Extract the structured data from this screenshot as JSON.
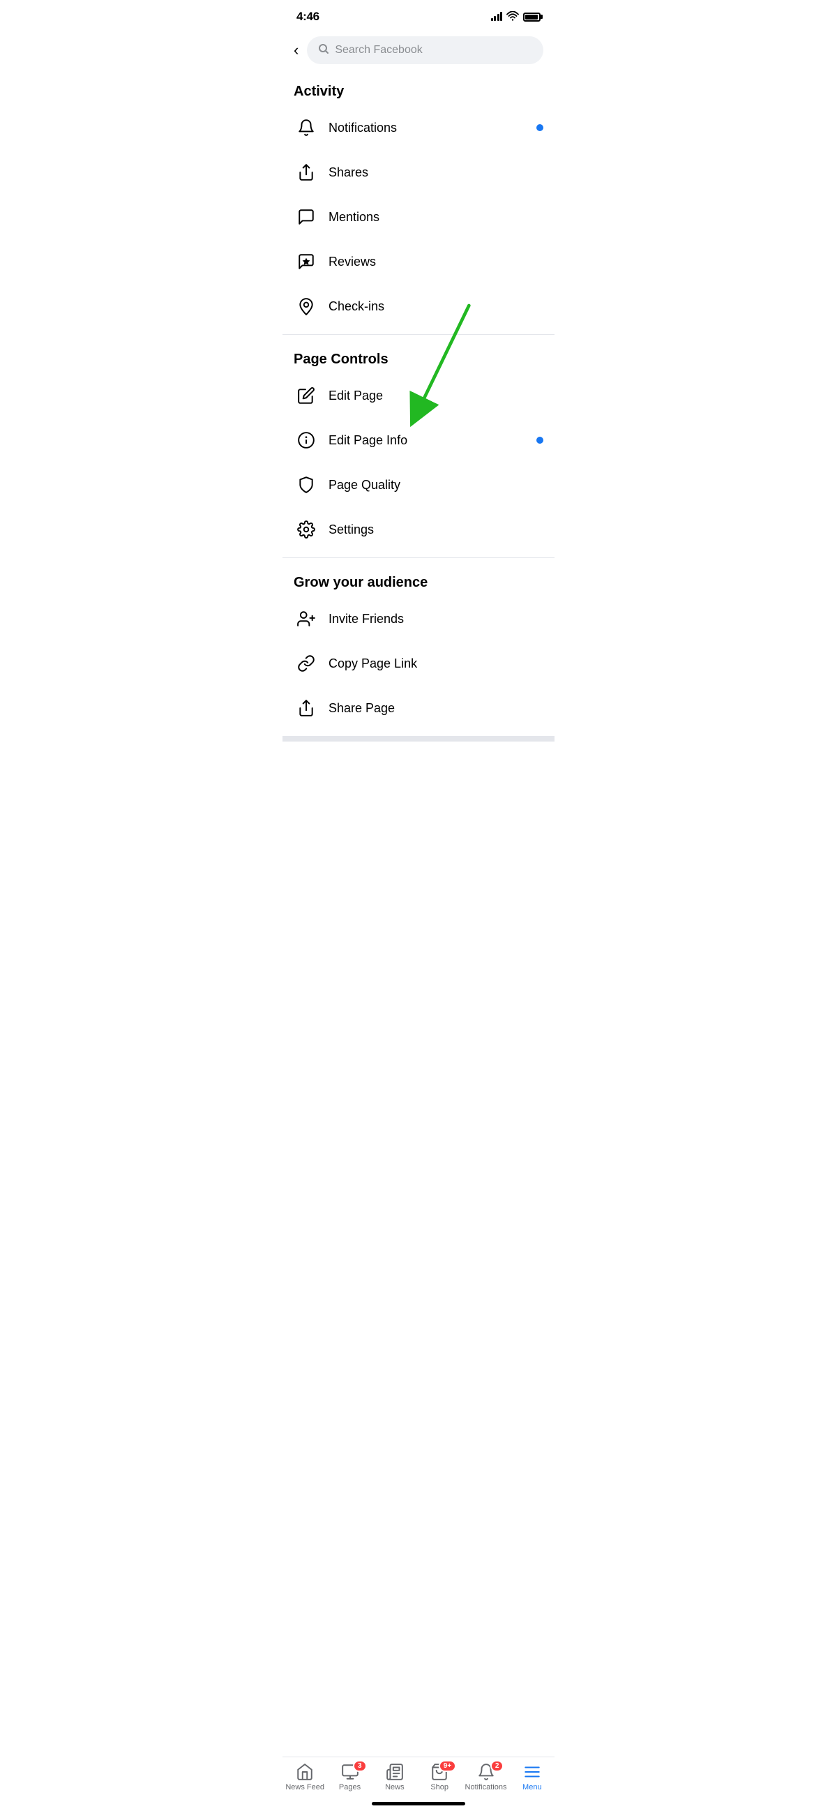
{
  "statusBar": {
    "time": "4:46",
    "signal": [
      4,
      7,
      10,
      13
    ],
    "battery": 85
  },
  "search": {
    "placeholder": "Search Facebook",
    "backLabel": "‹"
  },
  "sections": [
    {
      "id": "activity",
      "title": "Activity",
      "items": [
        {
          "id": "notifications",
          "label": "Notifications",
          "hasDot": true
        },
        {
          "id": "shares",
          "label": "Shares",
          "hasDot": false
        },
        {
          "id": "mentions",
          "label": "Mentions",
          "hasDot": false
        },
        {
          "id": "reviews",
          "label": "Reviews",
          "hasDot": false
        },
        {
          "id": "checkins",
          "label": "Check-ins",
          "hasDot": false
        }
      ]
    },
    {
      "id": "page-controls",
      "title": "Page Controls",
      "items": [
        {
          "id": "edit-page",
          "label": "Edit Page",
          "hasDot": false
        },
        {
          "id": "edit-page-info",
          "label": "Edit Page Info",
          "hasDot": true
        },
        {
          "id": "page-quality",
          "label": "Page Quality",
          "hasDot": false
        },
        {
          "id": "settings",
          "label": "Settings",
          "hasDot": false
        }
      ]
    },
    {
      "id": "grow-audience",
      "title": "Grow your audience",
      "items": [
        {
          "id": "invite-friends",
          "label": "Invite Friends",
          "hasDot": false
        },
        {
          "id": "copy-page-link",
          "label": "Copy Page Link",
          "hasDot": false
        },
        {
          "id": "share-page",
          "label": "Share Page",
          "hasDot": false
        }
      ]
    }
  ],
  "bottomNav": [
    {
      "id": "news-feed",
      "label": "News Feed",
      "badge": null,
      "active": false
    },
    {
      "id": "pages",
      "label": "Pages",
      "badge": "3",
      "active": false
    },
    {
      "id": "news",
      "label": "News",
      "badge": null,
      "active": false
    },
    {
      "id": "shop",
      "label": "Shop",
      "badge": "9+",
      "active": false
    },
    {
      "id": "notifications-nav",
      "label": "Notifications",
      "badge": "2",
      "active": false
    },
    {
      "id": "menu",
      "label": "Menu",
      "badge": null,
      "active": true
    }
  ]
}
